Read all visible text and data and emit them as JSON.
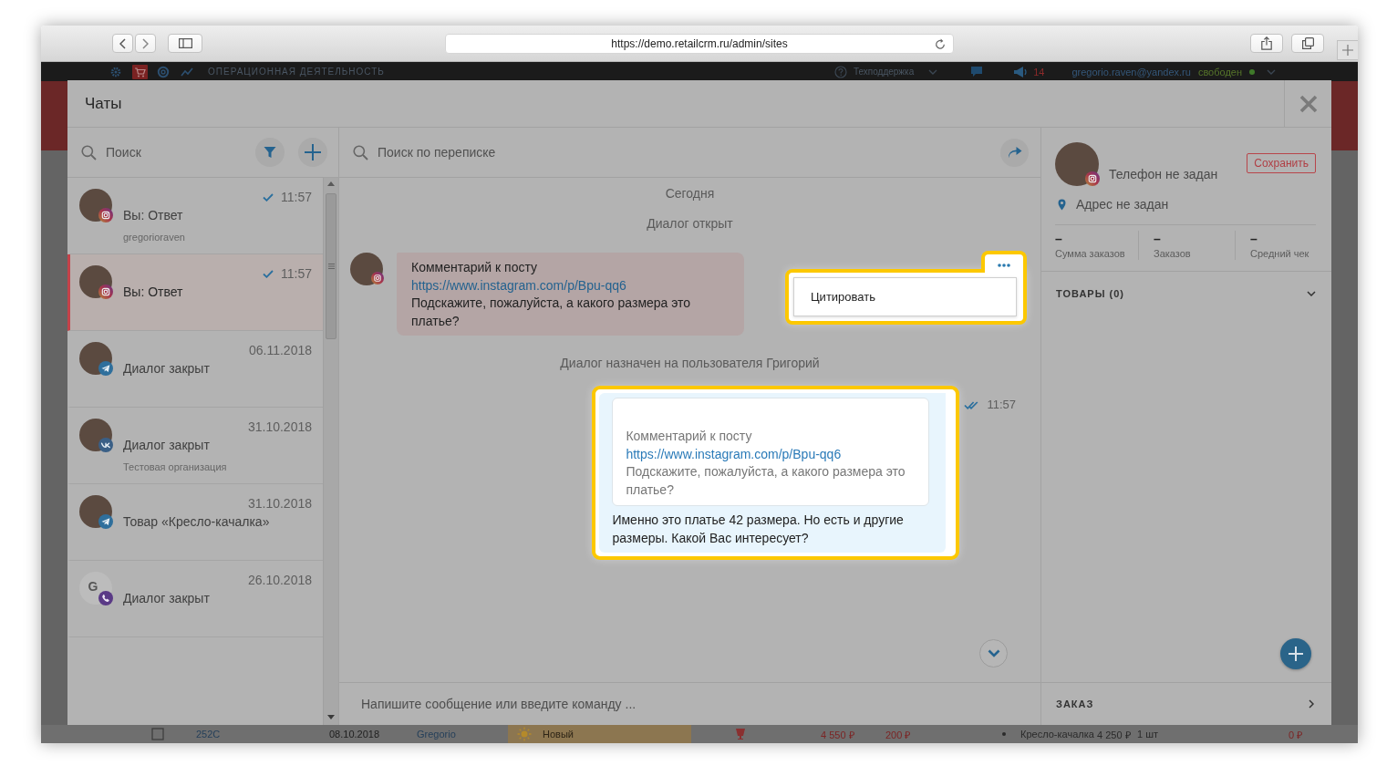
{
  "browser": {
    "url": "https://demo.retailcrm.ru/admin/sites"
  },
  "app_header": {
    "section": "ОПЕРАЦИОННАЯ ДЕЯТЕЛЬНОСТЬ",
    "support": "Техподдержка",
    "notifications": "14",
    "user_email": "gregorio.raven@yandex.ru",
    "user_status": "свободен",
    "online": true
  },
  "background_row": {
    "number": "252С",
    "date": "08.10.2018",
    "customer": "Gregorio",
    "status": "Новый",
    "total": "4 550 ₽",
    "delivery": "200 ₽",
    "product": "Кресло-качалка",
    "price": "4 250 ₽",
    "quantity": "1 шт",
    "paid": "0 ₽"
  },
  "modal": {
    "title": "Чаты"
  },
  "chat_list": {
    "search_placeholder": "Поиск",
    "items": [
      {
        "badge": {
          "kind": "instagram"
        },
        "time": "11:57",
        "delivered": true,
        "preview": "Вы: Ответ",
        "subtitle": "gregorioraven",
        "selected": false
      },
      {
        "badge": {
          "kind": "instagram"
        },
        "time": "11:57",
        "delivered": true,
        "preview": "Вы: Ответ",
        "selected": true
      },
      {
        "badge": {
          "kind": "telegram"
        },
        "time": "06.11.2018",
        "delivered": false,
        "preview": "Диалог закрыт",
        "selected": false
      },
      {
        "badge": {
          "kind": "vk"
        },
        "time": "31.10.2018",
        "delivered": false,
        "preview": "Диалог закрыт",
        "subtitle": "Тестовая организация",
        "selected": false
      },
      {
        "badge": {
          "kind": "telegram"
        },
        "time": "31.10.2018",
        "delivered": false,
        "preview": "Товар «Кресло-качалка»",
        "selected": false
      },
      {
        "badge": {
          "kind": "viber"
        },
        "initial": "G",
        "time": "26.10.2018",
        "delivered": false,
        "preview": "Диалог закрыт",
        "selected": false
      }
    ]
  },
  "conversation": {
    "search_placeholder": "Поиск по переписке",
    "messages": [
      {
        "kind": "system",
        "text": "Сегодня"
      },
      {
        "kind": "system",
        "text": "Диалог открыт"
      },
      {
        "kind": "incoming",
        "badge": {
          "kind": "instagram"
        },
        "title": "Комментарий к посту",
        "link": "https://www.instagram.com/p/Bpu-qq6",
        "text": "Подскажите, пожалуйста, а какого размера это платье?",
        "menu": {
          "highlighted": true,
          "items": [
            "Цитировать"
          ]
        }
      },
      {
        "kind": "system",
        "text": "Диалог назначен на пользователя Григорий"
      },
      {
        "kind": "outgoing",
        "highlighted": true,
        "quote": {
          "title": "Комментарий к посту",
          "link": "https://www.instagram.com/p/Bpu-qq6",
          "text": "Подскажите, пожалуйста, а какого размера это платье?"
        },
        "text": "Именно это платье 42 размера. Но есть и другие размеры. Какой Вас интересует?",
        "time": "11:57",
        "read": true
      }
    ],
    "composer_placeholder": "Напишите сообщение или введите команду ..."
  },
  "customer": {
    "badge": {
      "kind": "instagram"
    },
    "phone": "Телефон не задан",
    "address": "Адрес не задан",
    "save_label": "Сохранить",
    "stats": [
      {
        "value": "–",
        "label": "Сумма заказов"
      },
      {
        "value": "–",
        "label": "Заказов"
      },
      {
        "value": "–",
        "label": "Средний чек"
      }
    ],
    "products_title": "ТОВАРЫ (0)",
    "order_title": "ЗАКАЗ"
  }
}
